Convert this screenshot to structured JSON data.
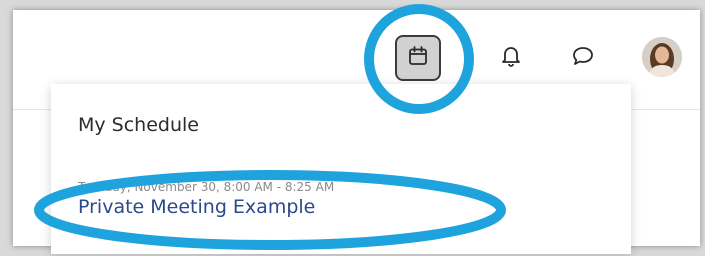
{
  "header": {
    "icons": {
      "calendar": "calendar-icon",
      "notifications": "bell-icon",
      "messages": "chat-bubble-icon",
      "profile": "avatar"
    }
  },
  "schedule": {
    "title": "My Schedule",
    "events": [
      {
        "datetime": "Tuesday, November 30, 8:00 AM - 8:25 AM",
        "name": "Private Meeting Example"
      }
    ]
  },
  "colors": {
    "annotation_ring": "#1fa3dc",
    "meeting_link": "#2a4a8a"
  }
}
